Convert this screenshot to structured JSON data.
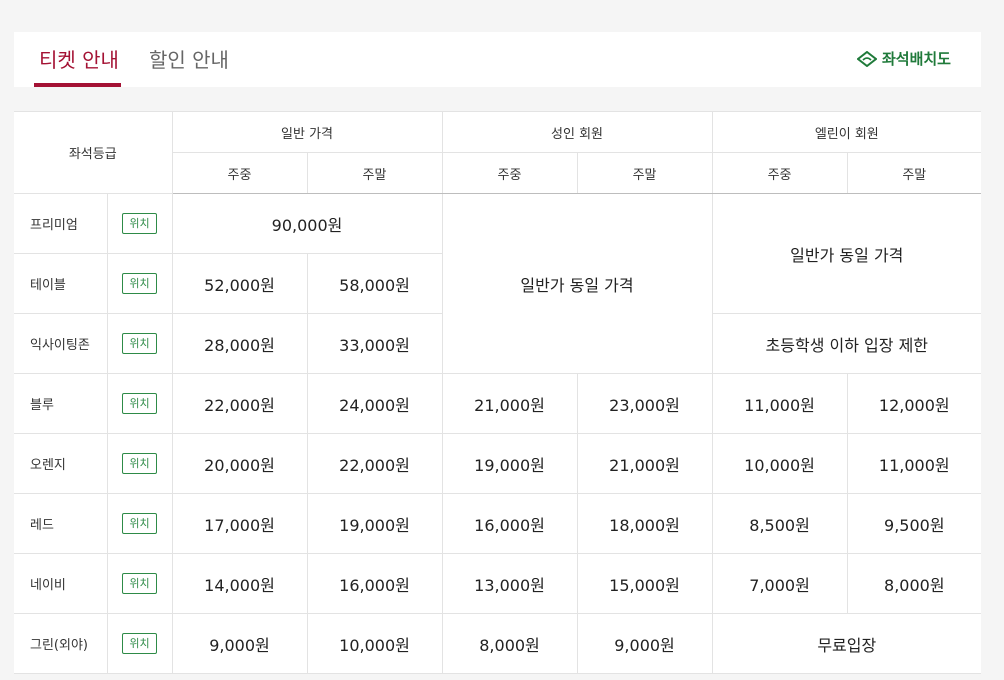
{
  "tabs": [
    {
      "label": "티켓 안내",
      "active": true
    },
    {
      "label": "할인 안내",
      "active": false
    }
  ],
  "seat_map_link": "좌석배치도",
  "colors": {
    "accent": "#a41234",
    "green": "#2e8b47"
  },
  "table": {
    "header": {
      "grade": "좌석등급",
      "groups": [
        "일반 가격",
        "성인 회원",
        "엘린이 회원"
      ],
      "weekday": "주중",
      "weekend": "주말"
    },
    "location_label": "위치",
    "rows": [
      {
        "grade": "프리미엄"
      },
      {
        "grade": "테이블"
      },
      {
        "grade": "익사이팅존"
      },
      {
        "grade": "블루"
      },
      {
        "grade": "오렌지"
      },
      {
        "grade": "레드"
      },
      {
        "grade": "네이비"
      },
      {
        "grade": "그린(외야)"
      }
    ],
    "notes": {
      "same_as_general": "일반가 동일 가격",
      "elementary_restricted": "초등학생 이하 입장 제한",
      "free_entry": "무료입장"
    },
    "prices": {
      "premium": "90,000원",
      "table": [
        "52,000원",
        "58,000원"
      ],
      "exciting": [
        "28,000원",
        "33,000원"
      ],
      "blue": [
        "22,000원",
        "24,000원",
        "21,000원",
        "23,000원",
        "11,000원",
        "12,000원"
      ],
      "orange": [
        "20,000원",
        "22,000원",
        "19,000원",
        "21,000원",
        "10,000원",
        "11,000원"
      ],
      "red": [
        "17,000원",
        "19,000원",
        "16,000원",
        "18,000원",
        "8,500원",
        "9,500원"
      ],
      "navy": [
        "14,000원",
        "16,000원",
        "13,000원",
        "15,000원",
        "7,000원",
        "8,000원"
      ],
      "green": [
        "9,000원",
        "10,000원",
        "8,000원",
        "9,000원"
      ]
    }
  }
}
